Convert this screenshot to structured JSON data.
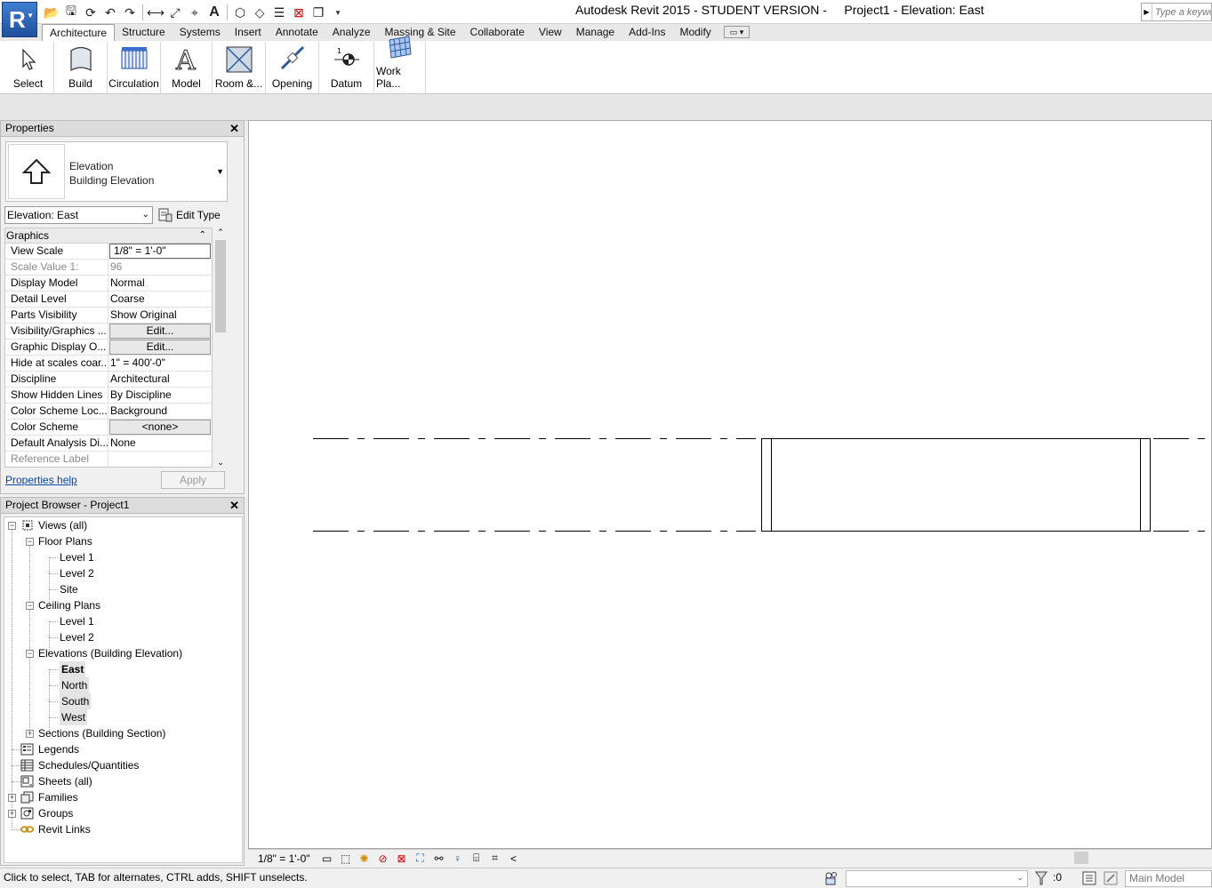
{
  "app": {
    "logo_letter": "R",
    "window_title": "Autodesk Revit 2015 - STUDENT VERSION -     Project1 - Elevation: East",
    "search_placeholder": "Type a keyword"
  },
  "ribbon": {
    "tabs": [
      "Architecture",
      "Structure",
      "Systems",
      "Insert",
      "Annotate",
      "Analyze",
      "Massing & Site",
      "Collaborate",
      "View",
      "Manage",
      "Add-Ins",
      "Modify"
    ],
    "active_tab": "Architecture",
    "buttons": [
      {
        "label": "Select",
        "icon": "cursor-icon"
      },
      {
        "label": "Build",
        "icon": "wall-icon"
      },
      {
        "label": "Circulation",
        "icon": "stair-icon"
      },
      {
        "label": "Model",
        "icon": "model-text-icon"
      },
      {
        "label": "Room &...",
        "icon": "room-icon"
      },
      {
        "label": "Opening",
        "icon": "opening-icon"
      },
      {
        "label": "Datum",
        "icon": "datum-icon"
      },
      {
        "label": "Work Pla...",
        "icon": "work-plane-icon"
      }
    ]
  },
  "properties": {
    "title": "Properties",
    "type_family": "Elevation",
    "type_name": "Building Elevation",
    "instance_selector": "Elevation: East",
    "edit_type_label": "Edit Type",
    "group_name": "Graphics",
    "rows": [
      {
        "name": "View Scale",
        "value": "1/8\" = 1'-0\"",
        "kind": "field"
      },
      {
        "name": "Scale Value    1:",
        "value": "96",
        "kind": "dim"
      },
      {
        "name": "Display Model",
        "value": "Normal",
        "kind": "text"
      },
      {
        "name": "Detail Level",
        "value": "Coarse",
        "kind": "text"
      },
      {
        "name": "Parts Visibility",
        "value": "Show Original",
        "kind": "text"
      },
      {
        "name": "Visibility/Graphics ...",
        "value": "Edit...",
        "kind": "button"
      },
      {
        "name": "Graphic Display O...",
        "value": "Edit...",
        "kind": "button"
      },
      {
        "name": "Hide at scales coar...",
        "value": "1\" = 400'-0\"",
        "kind": "text"
      },
      {
        "name": "Discipline",
        "value": "Architectural",
        "kind": "text"
      },
      {
        "name": "Show Hidden Lines",
        "value": "By Discipline",
        "kind": "text"
      },
      {
        "name": "Color Scheme Loc...",
        "value": "Background",
        "kind": "text"
      },
      {
        "name": "Color Scheme",
        "value": "<none>",
        "kind": "button"
      },
      {
        "name": "Default Analysis Di...",
        "value": "None",
        "kind": "text"
      },
      {
        "name": "Reference Label",
        "value": "",
        "kind": "dim"
      }
    ],
    "help_link": "Properties help",
    "apply_label": "Apply"
  },
  "project_browser": {
    "title": "Project Browser - Project1",
    "tree": [
      {
        "label": "Views (all)",
        "level": 0,
        "expander": "-",
        "icon": "views-icon"
      },
      {
        "label": "Floor Plans",
        "level": 1,
        "expander": "-"
      },
      {
        "label": "Level 1",
        "level": 2
      },
      {
        "label": "Level 2",
        "level": 2
      },
      {
        "label": "Site",
        "level": 2
      },
      {
        "label": "Ceiling Plans",
        "level": 1,
        "expander": "-"
      },
      {
        "label": "Level 1",
        "level": 2
      },
      {
        "label": "Level 2",
        "level": 2
      },
      {
        "label": "Elevations (Building Elevation)",
        "level": 1,
        "expander": "-"
      },
      {
        "label": "East",
        "level": 2,
        "state": "selected"
      },
      {
        "label": "North",
        "level": 2,
        "state": "highlight"
      },
      {
        "label": "South",
        "level": 2,
        "state": "highlight"
      },
      {
        "label": "West",
        "level": 2,
        "state": "highlight"
      },
      {
        "label": "Sections (Building Section)",
        "level": 1,
        "expander": "+"
      },
      {
        "label": "Legends",
        "level": 0,
        "icon": "legends-icon"
      },
      {
        "label": "Schedules/Quantities",
        "level": 0,
        "icon": "schedules-icon"
      },
      {
        "label": "Sheets (all)",
        "level": 0,
        "icon": "sheets-icon"
      },
      {
        "label": "Families",
        "level": 0,
        "expander": "+",
        "icon": "families-icon"
      },
      {
        "label": "Groups",
        "level": 0,
        "expander": "+",
        "icon": "groups-icon"
      },
      {
        "label": "Revit Links",
        "level": 0,
        "icon": "revit-links-icon"
      }
    ]
  },
  "view_control": {
    "scale": "1/8\" = 1'-0\""
  },
  "status": {
    "message": "Click to select, TAB for alternates, CTRL adds, SHIFT unselects.",
    "selection_count": ":0",
    "active_model": "Main Model"
  },
  "colors": {
    "app_button": "#2f66b8",
    "canvas": "#ffffff",
    "link": "#0645ad",
    "revit_links_icon": "#d4a017"
  }
}
